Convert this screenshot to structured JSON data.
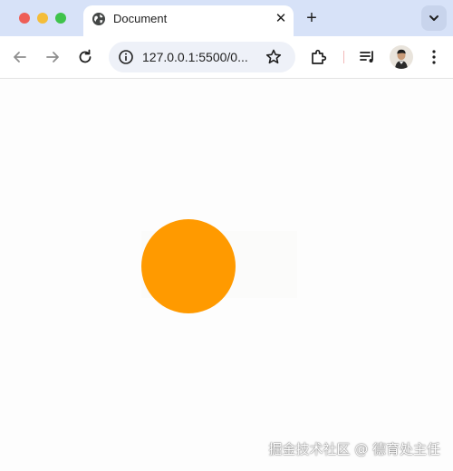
{
  "browser": {
    "tab": {
      "title": "Document",
      "icon": "globe-icon",
      "close_glyph": "✕"
    },
    "new_tab_glyph": "+",
    "address_bar": {
      "url": "127.0.0.1:5500/0..."
    },
    "colors": {
      "tabstrip_bg": "#d7e2f8",
      "omnibox_bg": "#eef1f8"
    }
  },
  "page": {
    "shape": "circle",
    "shape_color": "#ff9a00"
  },
  "watermark": {
    "text": "掘金技术社区 @ 德育处主任"
  }
}
